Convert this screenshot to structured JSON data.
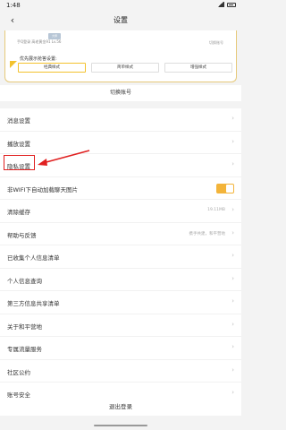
{
  "status": {
    "time": "1:48"
  },
  "nav": {
    "title": "设置"
  },
  "card": {
    "badge": "大师",
    "profile_line": "手Q登录  高老黄金91  Lv.56",
    "right_text": "切换账号",
    "style_label": "优先展示抢答设置:",
    "options": [
      "经典样式",
      "简单样式",
      "增强样式"
    ],
    "selected_index": 0
  },
  "switch_account": "切换账号",
  "menu": [
    {
      "label": "消息设置"
    },
    {
      "label": "播放设置"
    },
    {
      "label": "隐私设置"
    },
    {
      "label": "非WIFI下自动加载聊天图片",
      "toggle": true
    },
    {
      "label": "清除缓存",
      "value": "19.11MB"
    },
    {
      "label": "帮助与反馈",
      "value": "携手共建，和平营地"
    },
    {
      "label": "已收集个人信息清单"
    },
    {
      "label": "个人信息查询"
    },
    {
      "label": "第三方信息共享清单"
    },
    {
      "label": "关于和平营地"
    },
    {
      "label": "专属流量服务"
    },
    {
      "label": "社区公约"
    },
    {
      "label": "账号安全"
    }
  ],
  "logout": "退出登录",
  "colors": {
    "accent": "#f3b43a",
    "annotation": "#e02020"
  }
}
